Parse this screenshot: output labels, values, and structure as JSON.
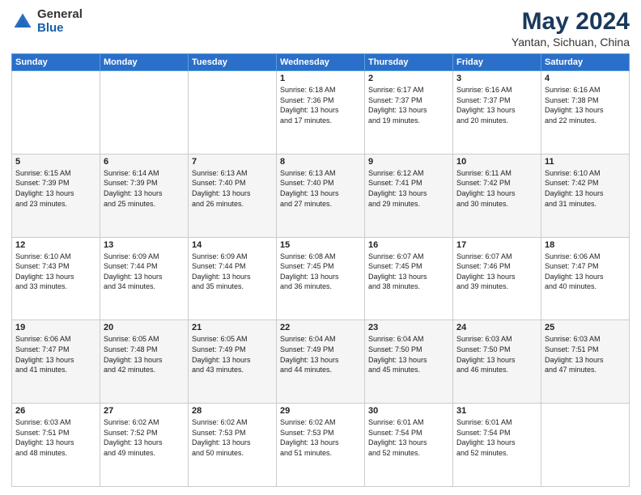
{
  "header": {
    "logo_general": "General",
    "logo_blue": "Blue",
    "title": "May 2024",
    "subtitle": "Yantan, Sichuan, China"
  },
  "weekdays": [
    "Sunday",
    "Monday",
    "Tuesday",
    "Wednesday",
    "Thursday",
    "Friday",
    "Saturday"
  ],
  "weeks": [
    [
      {
        "day": "",
        "info": ""
      },
      {
        "day": "",
        "info": ""
      },
      {
        "day": "",
        "info": ""
      },
      {
        "day": "1",
        "info": "Sunrise: 6:18 AM\nSunset: 7:36 PM\nDaylight: 13 hours\nand 17 minutes."
      },
      {
        "day": "2",
        "info": "Sunrise: 6:17 AM\nSunset: 7:37 PM\nDaylight: 13 hours\nand 19 minutes."
      },
      {
        "day": "3",
        "info": "Sunrise: 6:16 AM\nSunset: 7:37 PM\nDaylight: 13 hours\nand 20 minutes."
      },
      {
        "day": "4",
        "info": "Sunrise: 6:16 AM\nSunset: 7:38 PM\nDaylight: 13 hours\nand 22 minutes."
      }
    ],
    [
      {
        "day": "5",
        "info": "Sunrise: 6:15 AM\nSunset: 7:39 PM\nDaylight: 13 hours\nand 23 minutes."
      },
      {
        "day": "6",
        "info": "Sunrise: 6:14 AM\nSunset: 7:39 PM\nDaylight: 13 hours\nand 25 minutes."
      },
      {
        "day": "7",
        "info": "Sunrise: 6:13 AM\nSunset: 7:40 PM\nDaylight: 13 hours\nand 26 minutes."
      },
      {
        "day": "8",
        "info": "Sunrise: 6:13 AM\nSunset: 7:40 PM\nDaylight: 13 hours\nand 27 minutes."
      },
      {
        "day": "9",
        "info": "Sunrise: 6:12 AM\nSunset: 7:41 PM\nDaylight: 13 hours\nand 29 minutes."
      },
      {
        "day": "10",
        "info": "Sunrise: 6:11 AM\nSunset: 7:42 PM\nDaylight: 13 hours\nand 30 minutes."
      },
      {
        "day": "11",
        "info": "Sunrise: 6:10 AM\nSunset: 7:42 PM\nDaylight: 13 hours\nand 31 minutes."
      }
    ],
    [
      {
        "day": "12",
        "info": "Sunrise: 6:10 AM\nSunset: 7:43 PM\nDaylight: 13 hours\nand 33 minutes."
      },
      {
        "day": "13",
        "info": "Sunrise: 6:09 AM\nSunset: 7:44 PM\nDaylight: 13 hours\nand 34 minutes."
      },
      {
        "day": "14",
        "info": "Sunrise: 6:09 AM\nSunset: 7:44 PM\nDaylight: 13 hours\nand 35 minutes."
      },
      {
        "day": "15",
        "info": "Sunrise: 6:08 AM\nSunset: 7:45 PM\nDaylight: 13 hours\nand 36 minutes."
      },
      {
        "day": "16",
        "info": "Sunrise: 6:07 AM\nSunset: 7:45 PM\nDaylight: 13 hours\nand 38 minutes."
      },
      {
        "day": "17",
        "info": "Sunrise: 6:07 AM\nSunset: 7:46 PM\nDaylight: 13 hours\nand 39 minutes."
      },
      {
        "day": "18",
        "info": "Sunrise: 6:06 AM\nSunset: 7:47 PM\nDaylight: 13 hours\nand 40 minutes."
      }
    ],
    [
      {
        "day": "19",
        "info": "Sunrise: 6:06 AM\nSunset: 7:47 PM\nDaylight: 13 hours\nand 41 minutes."
      },
      {
        "day": "20",
        "info": "Sunrise: 6:05 AM\nSunset: 7:48 PM\nDaylight: 13 hours\nand 42 minutes."
      },
      {
        "day": "21",
        "info": "Sunrise: 6:05 AM\nSunset: 7:49 PM\nDaylight: 13 hours\nand 43 minutes."
      },
      {
        "day": "22",
        "info": "Sunrise: 6:04 AM\nSunset: 7:49 PM\nDaylight: 13 hours\nand 44 minutes."
      },
      {
        "day": "23",
        "info": "Sunrise: 6:04 AM\nSunset: 7:50 PM\nDaylight: 13 hours\nand 45 minutes."
      },
      {
        "day": "24",
        "info": "Sunrise: 6:03 AM\nSunset: 7:50 PM\nDaylight: 13 hours\nand 46 minutes."
      },
      {
        "day": "25",
        "info": "Sunrise: 6:03 AM\nSunset: 7:51 PM\nDaylight: 13 hours\nand 47 minutes."
      }
    ],
    [
      {
        "day": "26",
        "info": "Sunrise: 6:03 AM\nSunset: 7:51 PM\nDaylight: 13 hours\nand 48 minutes."
      },
      {
        "day": "27",
        "info": "Sunrise: 6:02 AM\nSunset: 7:52 PM\nDaylight: 13 hours\nand 49 minutes."
      },
      {
        "day": "28",
        "info": "Sunrise: 6:02 AM\nSunset: 7:53 PM\nDaylight: 13 hours\nand 50 minutes."
      },
      {
        "day": "29",
        "info": "Sunrise: 6:02 AM\nSunset: 7:53 PM\nDaylight: 13 hours\nand 51 minutes."
      },
      {
        "day": "30",
        "info": "Sunrise: 6:01 AM\nSunset: 7:54 PM\nDaylight: 13 hours\nand 52 minutes."
      },
      {
        "day": "31",
        "info": "Sunrise: 6:01 AM\nSunset: 7:54 PM\nDaylight: 13 hours\nand 52 minutes."
      },
      {
        "day": "",
        "info": ""
      }
    ]
  ]
}
